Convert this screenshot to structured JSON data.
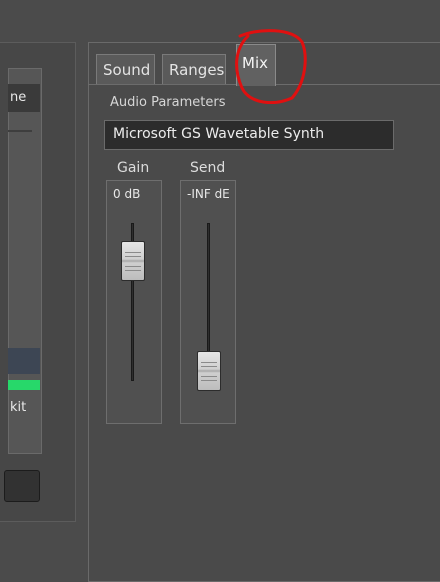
{
  "left_panel": {
    "header_text": "ne",
    "item_text": "kit"
  },
  "tabs": [
    {
      "label": "Sound"
    },
    {
      "label": "Ranges"
    },
    {
      "label": "Mix",
      "active": true
    }
  ],
  "section": {
    "title": "Audio Parameters",
    "device": "Microsoft GS Wavetable Synth"
  },
  "channels": {
    "gain": {
      "label": "Gain",
      "value": "0 dB"
    },
    "send": {
      "label": "Send",
      "value": "-INF dE"
    }
  },
  "colors": {
    "annotation_circle": "#e01010",
    "meter": "#27d86a",
    "selected_row": "#3d4654"
  }
}
